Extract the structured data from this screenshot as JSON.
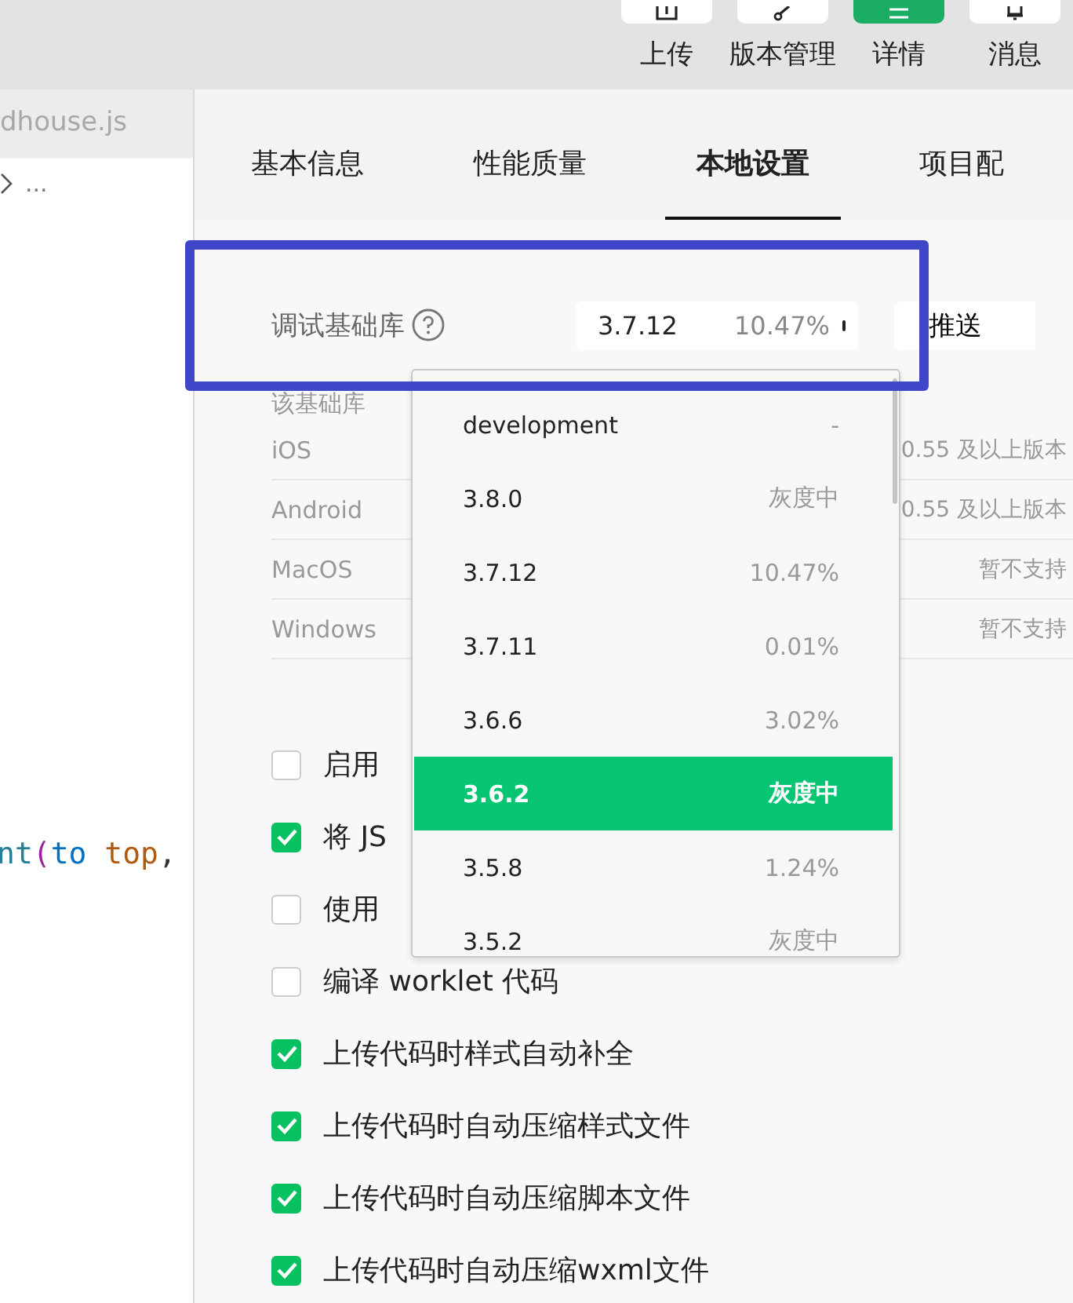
{
  "toolbar": [
    {
      "label": "上传",
      "selected": false
    },
    {
      "label": "版本管理",
      "selected": false
    },
    {
      "label": "详情",
      "selected": true
    },
    {
      "label": "消息",
      "selected": false
    }
  ],
  "editor": {
    "file_tab": "dhouse.js",
    "breadcrumb": "...",
    "code_tokens": [
      {
        "text": "nt",
        "kind": "func"
      },
      {
        "text": "(",
        "kind": "paren"
      },
      {
        "text": "to",
        "kind": "keyword"
      },
      {
        "text": "top",
        "kind": "value"
      },
      {
        "text": ",",
        "kind": "plain"
      }
    ]
  },
  "tabs": [
    {
      "label": "基本信息",
      "selected": false
    },
    {
      "label": "性能质量",
      "selected": false
    },
    {
      "label": "本地设置",
      "selected": true
    },
    {
      "label": "项目配",
      "selected": false
    }
  ],
  "debug_lib": {
    "label": "调试基础库",
    "version": "3.7.12",
    "share": "10.47%",
    "push_button": "推送",
    "note": "该基础库",
    "platforms": [
      {
        "name": "iOS",
        "support": "0.55 及以上版本"
      },
      {
        "name": "Android",
        "support": "0.55 及以上版本"
      },
      {
        "name": "MacOS",
        "support": "暂不支持"
      },
      {
        "name": "Windows",
        "support": "暂不支持"
      }
    ]
  },
  "dropdown": [
    {
      "version": "development",
      "share": "-",
      "selected": false
    },
    {
      "version": "3.8.0",
      "share": "灰度中",
      "selected": false
    },
    {
      "version": "3.7.12",
      "share": "10.47%",
      "selected": false
    },
    {
      "version": "3.7.11",
      "share": "0.01%",
      "selected": false
    },
    {
      "version": "3.6.6",
      "share": "3.02%",
      "selected": false
    },
    {
      "version": "3.6.2",
      "share": "灰度中",
      "selected": true
    },
    {
      "version": "3.5.8",
      "share": "1.24%",
      "selected": false
    },
    {
      "version": "3.5.2",
      "share": "灰度中",
      "selected": false
    }
  ],
  "options": [
    {
      "label": "启用",
      "checked": false
    },
    {
      "label": "将 JS",
      "checked": true
    },
    {
      "label": "使用",
      "checked": false
    },
    {
      "label": "编译 worklet 代码",
      "checked": false
    },
    {
      "label": "上传代码时样式自动补全",
      "checked": true
    },
    {
      "label": "上传代码时自动压缩样式文件",
      "checked": true
    },
    {
      "label": "上传代码时自动压缩脚本文件",
      "checked": true
    },
    {
      "label": "上传代码时自动压缩wxml文件",
      "checked": true
    }
  ]
}
